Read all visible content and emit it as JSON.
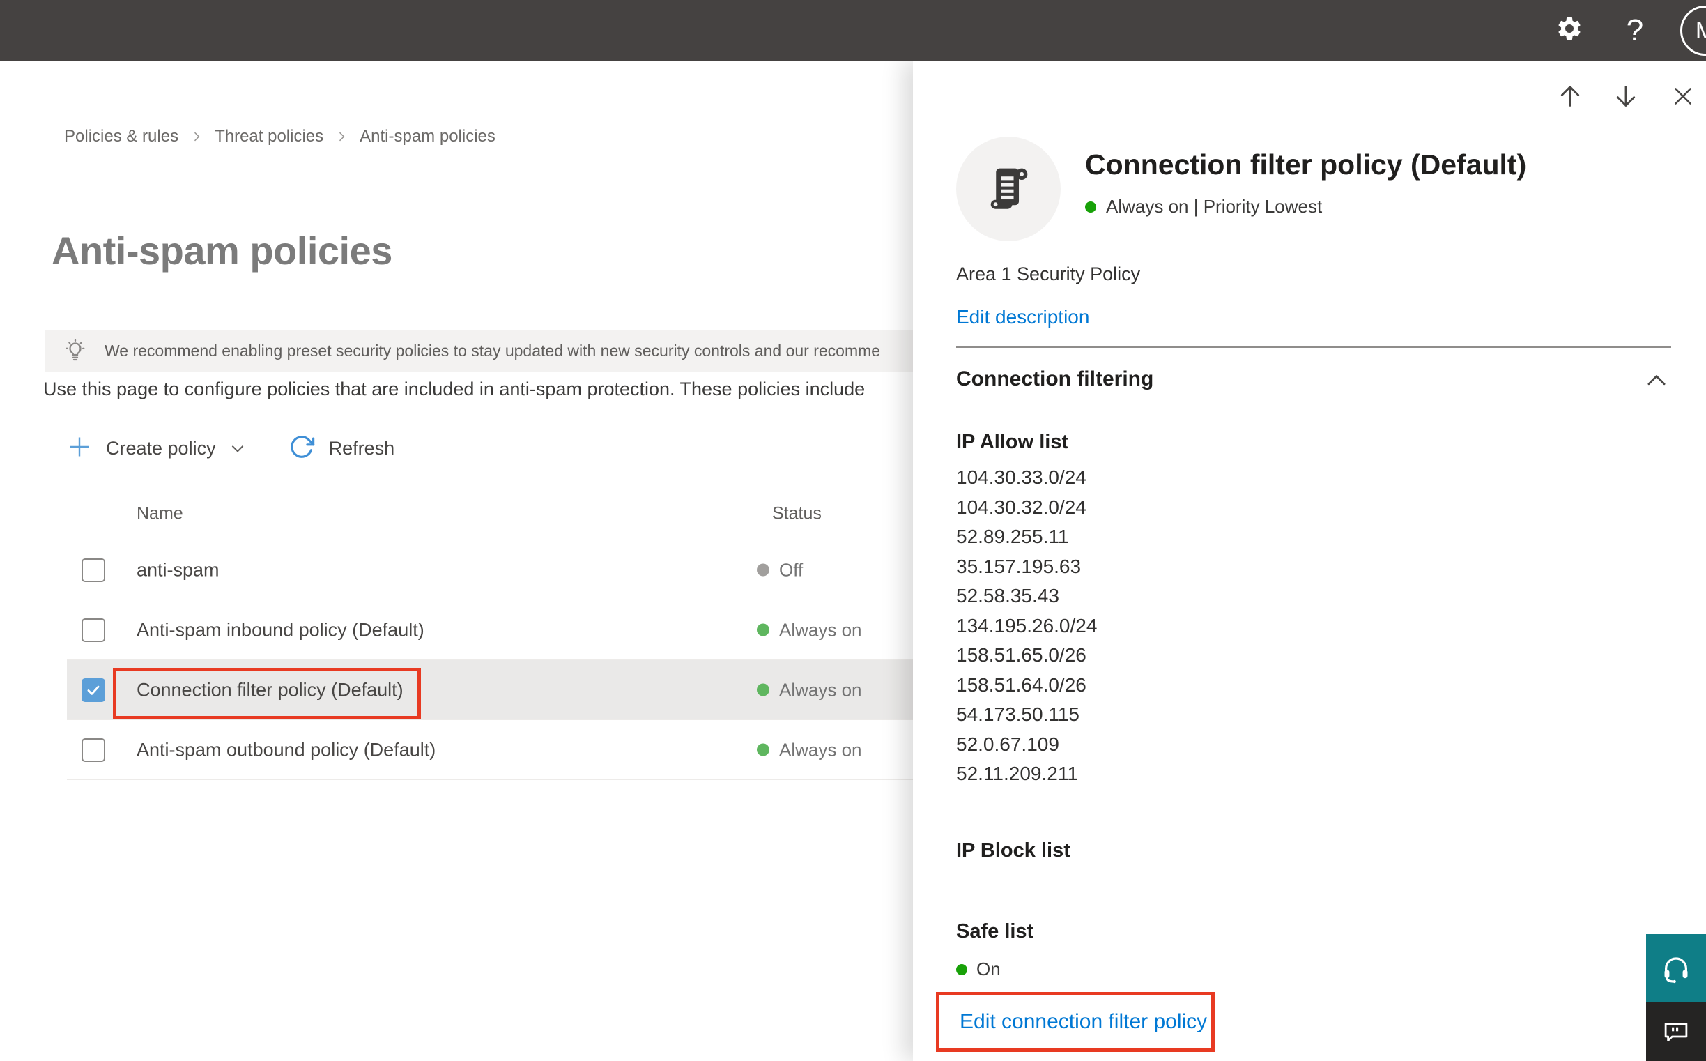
{
  "topbar": {
    "help_label": "?",
    "avatar_initial": "M"
  },
  "breadcrumb": {
    "items": [
      "Policies & rules",
      "Threat policies",
      "Anti-spam policies"
    ]
  },
  "page": {
    "title": "Anti-spam policies",
    "banner_text": "We recommend enabling preset security policies to stay updated with new security controls and our recomme",
    "description": "Use this page to configure policies that are included in anti-spam protection. These policies include"
  },
  "toolbar": {
    "create_policy_label": "Create policy",
    "refresh_label": "Refresh"
  },
  "table": {
    "columns": {
      "name": "Name",
      "status": "Status"
    },
    "rows": [
      {
        "name": "anti-spam",
        "status": "Off",
        "checked": false
      },
      {
        "name": "Anti-spam inbound policy (Default)",
        "status": "Always on",
        "checked": false
      },
      {
        "name": "Connection filter policy (Default)",
        "status": "Always on",
        "checked": true,
        "highlighted": true
      },
      {
        "name": "Anti-spam outbound policy (Default)",
        "status": "Always on",
        "checked": false
      }
    ]
  },
  "flyout": {
    "title": "Connection filter policy (Default)",
    "status_text": "Always on | Priority Lowest",
    "description": "Area 1 Security Policy",
    "edit_description_label": "Edit description",
    "section_title": "Connection filtering",
    "ip_allow_title": "IP Allow list",
    "ip_allow_list": [
      "104.30.33.0/24",
      "104.30.32.0/24",
      "52.89.255.11",
      "35.157.195.63",
      "52.58.35.43",
      "134.195.26.0/24",
      "158.51.65.0/26",
      "158.51.64.0/26",
      "54.173.50.115",
      "52.0.67.109",
      "52.11.209.211"
    ],
    "ip_block_title": "IP Block list",
    "safe_list_title": "Safe list",
    "safe_list_status": "On",
    "edit_policy_label": "Edit connection filter policy"
  },
  "colors": {
    "topbar_gray": "#454241",
    "accent_blue": "#0078d4",
    "status_on_green": "#5fb65f",
    "status_on_green_bright": "#18a108",
    "status_off_gray": "#a19f9d",
    "highlight_red": "#e83a22",
    "checkbox_blue": "#5c9fd8",
    "banner_gray": "#f3f2f1",
    "support_teal": "#0f7e87",
    "support_dark": "#252423"
  }
}
